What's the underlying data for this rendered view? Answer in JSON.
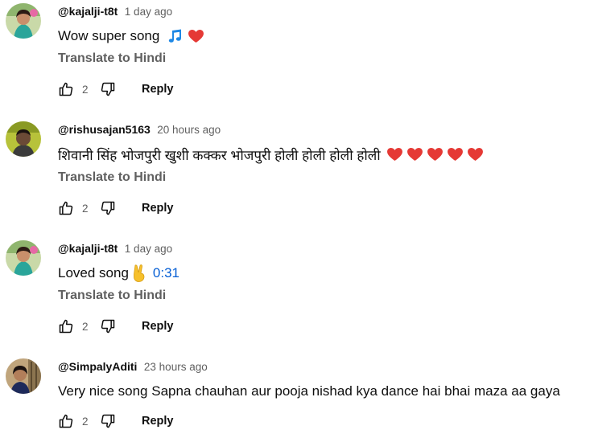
{
  "colors": {
    "text_primary": "#0f0f0f",
    "text_secondary": "#606060",
    "link_blue": "#065fd4",
    "heart_red": "#e53935",
    "music_note_blue": "#1e88e5"
  },
  "comments": [
    {
      "handle": "@kajalji-t8t",
      "time": "1 day ago",
      "text": "Wow super song",
      "emojis": [
        "music-note",
        "red-heart"
      ],
      "translate_label": "Translate to Hindi",
      "likes": "2",
      "reply_label": "Reply"
    },
    {
      "handle": "@rishusajan5163",
      "time": "20 hours ago",
      "text": "शिवानी सिंह भोजपुरी खुशी कक्कर भोजपुरी होली होली होली होली",
      "emojis": [
        "red-heart",
        "red-heart",
        "red-heart",
        "red-heart",
        "red-heart"
      ],
      "translate_label": "Translate to Hindi",
      "likes": "2",
      "reply_label": "Reply"
    },
    {
      "handle": "@kajalji-t8t",
      "time": "1 day ago",
      "text": "Loved song",
      "emojis": [
        "victory-hand"
      ],
      "timestamp_link": "0:31",
      "translate_label": "Translate to Hindi",
      "likes": "2",
      "reply_label": "Reply"
    },
    {
      "handle": "@SimpalyAditi",
      "time": "23 hours ago",
      "text": "Very nice song Sapna chauhan aur pooja nishad kya dance hai bhai maza aa gaya",
      "emojis": [],
      "likes": "2",
      "reply_label": "Reply"
    }
  ]
}
